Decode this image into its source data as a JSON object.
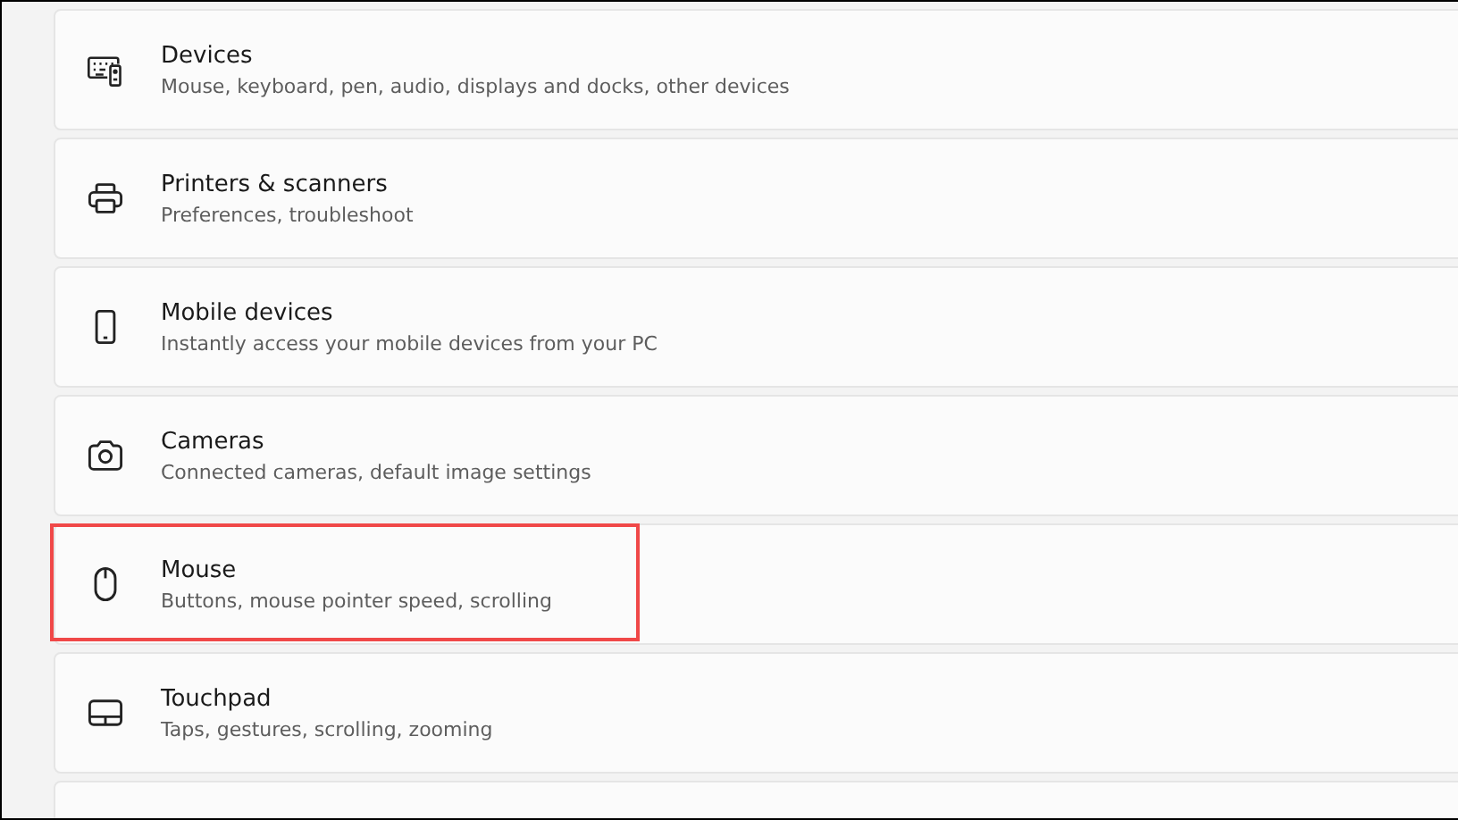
{
  "settings_items": [
    {
      "kind": "keyboard",
      "title": "Devices",
      "subtitle": "Mouse, keyboard, pen, audio, displays and docks, other devices",
      "highlighted": false
    },
    {
      "kind": "printer",
      "title": "Printers & scanners",
      "subtitle": "Preferences, troubleshoot",
      "highlighted": false
    },
    {
      "kind": "phone",
      "title": "Mobile devices",
      "subtitle": "Instantly access your mobile devices from your PC",
      "highlighted": false
    },
    {
      "kind": "camera",
      "title": "Cameras",
      "subtitle": "Connected cameras, default image settings",
      "highlighted": false
    },
    {
      "kind": "mouse",
      "title": "Mouse",
      "subtitle": "Buttons, mouse pointer speed, scrolling",
      "highlighted": true
    },
    {
      "kind": "touchpad",
      "title": "Touchpad",
      "subtitle": "Taps, gestures, scrolling, zooming",
      "highlighted": false
    },
    {
      "kind": "blank",
      "highlighted": false
    }
  ]
}
